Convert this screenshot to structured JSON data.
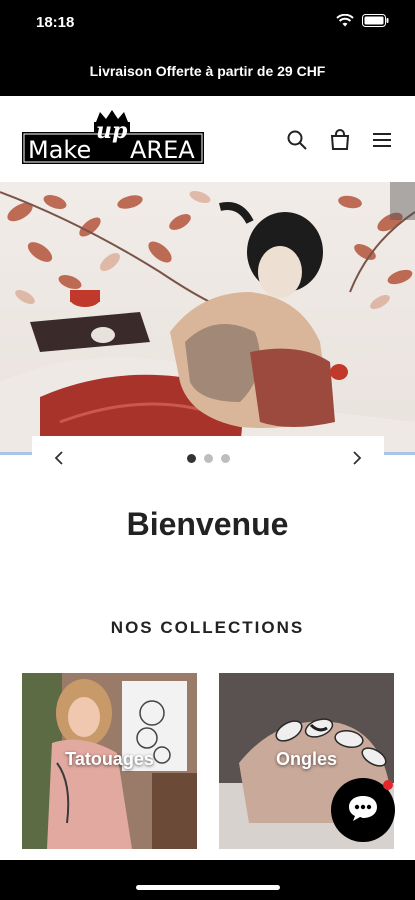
{
  "status": {
    "time": "18:18"
  },
  "announcement": {
    "text": "Livraison Offerte à partir de 29 CHF"
  },
  "logo": {
    "word1": "Make",
    "word2": "up",
    "word3": "AREA"
  },
  "slider": {
    "slides": 3,
    "active": 0
  },
  "welcome": {
    "title": "Bienvenue"
  },
  "collections": {
    "title": "NOS COLLECTIONS",
    "items": [
      {
        "label": "Tatouages"
      },
      {
        "label": "Ongles"
      }
    ]
  },
  "colors": {
    "announcement_bg": "#000000",
    "chat_badge": "#e3262b",
    "accent_line": "#a9c6ea"
  }
}
